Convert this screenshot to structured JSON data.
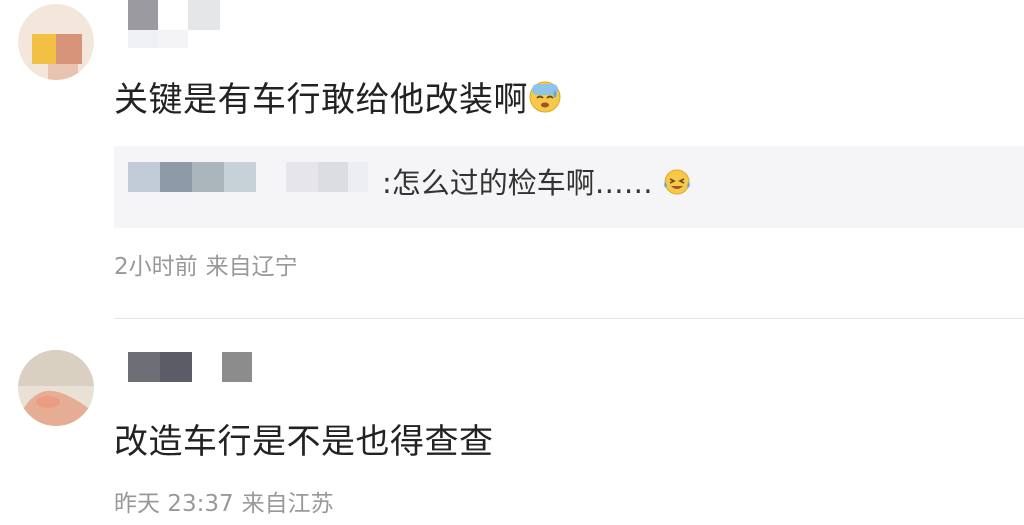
{
  "comments": [
    {
      "text": "关键是有车行敢给他改装啊",
      "emoji": "cold-sweat-emoji",
      "reply_quote": {
        "text": ":怎么过的检车啊……",
        "emoji": "laughing-crying-emoji"
      },
      "time": "2小时前",
      "location": "来自辽宁"
    },
    {
      "text": "改造车行是不是也得查查",
      "time": "昨天 23:37",
      "location": "来自江苏"
    }
  ],
  "colors": {
    "text": "#222222",
    "meta": "#999999",
    "quote_bg": "#f5f5f7",
    "divider": "#e6e6e6"
  }
}
